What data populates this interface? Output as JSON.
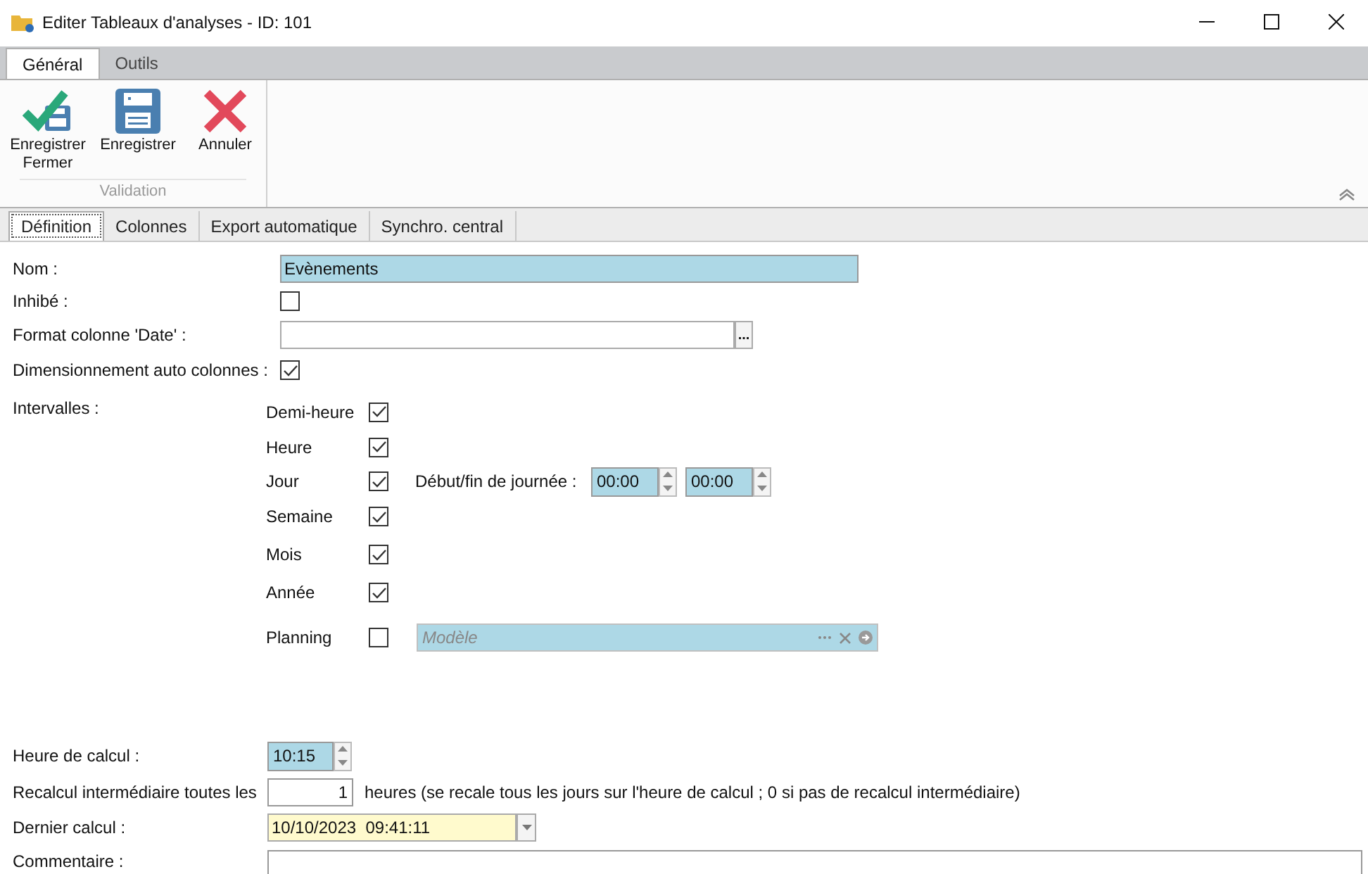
{
  "window": {
    "title": "Editer Tableaux d'analyses - ID: 101"
  },
  "ribbon_tabs": [
    {
      "label": "Général",
      "selected": true
    },
    {
      "label": "Outils",
      "selected": false
    }
  ],
  "ribbon_group": {
    "label": "Validation",
    "buttons": [
      {
        "kind": "save_close",
        "label": "Enregistrer Fermer"
      },
      {
        "kind": "save",
        "label": "Enregistrer"
      },
      {
        "kind": "cancel",
        "label": "Annuler"
      }
    ]
  },
  "form_tabs": [
    {
      "label": "Définition",
      "selected": true
    },
    {
      "label": "Colonnes",
      "selected": false
    },
    {
      "label": "Export automatique",
      "selected": false
    },
    {
      "label": "Synchro. central",
      "selected": false
    }
  ],
  "nom": {
    "label": "Nom :",
    "value": "Evènements"
  },
  "inhibe": {
    "label": "Inhibé :",
    "checked": false
  },
  "format_date": {
    "label": "Format colonne 'Date' :",
    "button": "..."
  },
  "dimensionnement": {
    "label": "Dimensionnement auto colonnes :",
    "checked": true
  },
  "intervalles": {
    "label": "Intervalles :",
    "items": [
      {
        "label": "Demi-heure",
        "checked": true
      },
      {
        "label": "Heure",
        "checked": true
      },
      {
        "label": "Jour",
        "checked": true,
        "extra": {
          "kind": "day_bounds",
          "label": "Début/fin de journée :",
          "start": "00:00",
          "end": "00:00"
        }
      },
      {
        "label": "Semaine",
        "checked": true
      },
      {
        "label": "Mois",
        "checked": true
      },
      {
        "label": "Année",
        "checked": true
      },
      {
        "label": "Planning",
        "checked": false,
        "extra": {
          "kind": "model",
          "placeholder": "Modèle"
        }
      }
    ]
  },
  "heure_calcul": {
    "label": "Heure de calcul :",
    "value": "10:15"
  },
  "recalcul": {
    "label": "Recalcul intermédiaire toutes les",
    "value": "1",
    "note": "heures (se recale tous les jours sur l'heure de calcul ; 0 si pas de recalcul intermédiaire)"
  },
  "dernier_calcul": {
    "label": "Dernier calcul :",
    "value": "10/10/2023  09:41:11"
  },
  "commentaire": {
    "label": "Commentaire :"
  }
}
